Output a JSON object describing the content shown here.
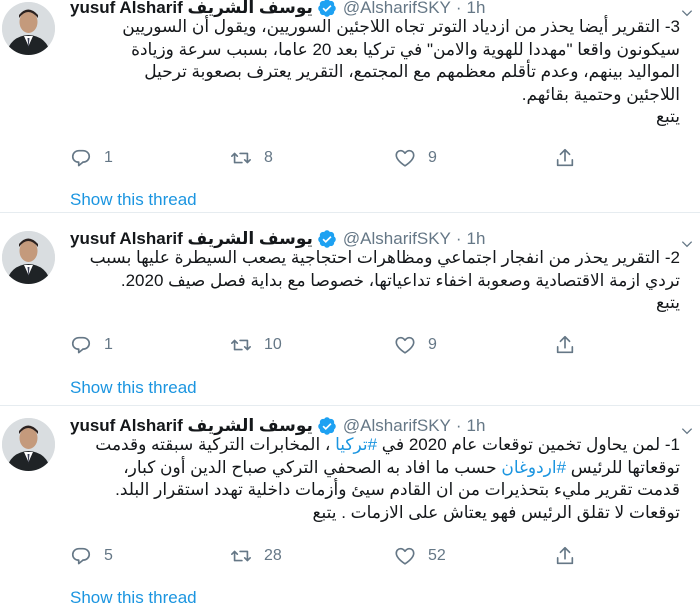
{
  "tweets": [
    {
      "display_name": "yusuf Alsharif يوسف الشريف",
      "handle": "@AlsharifSKY",
      "time": "1h",
      "lines": [
        "3- التقرير أيضا يحذر من ازدياد التوتر تجاه اللاجئين السوريين، ويقول أن السوريين",
        "سيكونون واقعا \"مهددا للهوية والامن\" في تركيا بعد 20 عاما، بسبب سرعة وزيادة",
        "المواليد بينهم، وعدم تأقلم معظمهم مع المجتمع، التقرير يعترف بصعوبة ترحيل",
        "اللاجئين وحتمية بقائهم.",
        "يتبع"
      ],
      "replies": "1",
      "retweets": "8",
      "likes": "9",
      "show_thread": "Show this thread"
    },
    {
      "display_name": "yusuf Alsharif يوسف الشريف",
      "handle": "@AlsharifSKY",
      "time": "1h",
      "lines": [
        "2- التقرير يحذر من انفجار اجتماعي ومظاهرات احتجاجية يصعب السيطرة عليها بسبب",
        "تردي ازمة الاقتصادية وصعوبة اخفاء تداعياتها، خصوصا مع بداية فصل صيف 2020.",
        "يتبع"
      ],
      "replies": "1",
      "retweets": "10",
      "likes": "9",
      "show_thread": "Show this thread"
    },
    {
      "display_name": "yusuf Alsharif يوسف الشريف",
      "handle": "@AlsharifSKY",
      "time": "1h",
      "line1_a": "1- لمن يحاول تخمين توقعات عام 2020 في ",
      "line1_tag": "#تركيا",
      "line1_b": " ، المخابرات التركية سبقته وقدمت",
      "line2_a": "توقعاتها للرئيس ",
      "line2_tag": "#اردوغان",
      "line2_b": " حسب ما افاد به الصحفي التركي صباح الدين أون كبار،",
      "line3": "قدمت تقرير مليء بتحذيرات من ان القادم سيئ وأزمات داخلية تهدد استقرار البلد.",
      "line4": "توقعات لا تقلق الرئيس فهو يعتاش على الازمات . يتبع",
      "replies": "5",
      "retweets": "28",
      "likes": "52",
      "show_thread": "Show this thread"
    }
  ],
  "icons": {
    "verified": "verified-badge-icon",
    "caret": "chevron-down-icon",
    "reply": "reply-icon",
    "retweet": "retweet-icon",
    "like": "heart-icon",
    "share": "share-icon"
  },
  "colors": {
    "link": "#1b95e0",
    "muted": "#657786",
    "verified": "#1da1f2",
    "divider": "#e6ecf0"
  }
}
